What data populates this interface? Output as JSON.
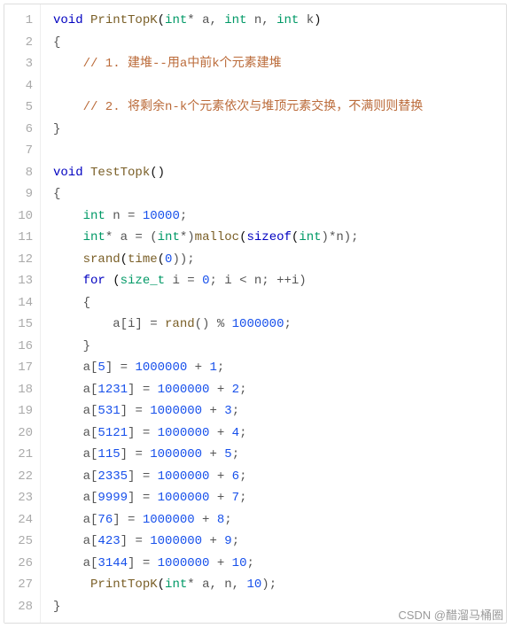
{
  "watermark": "CSDN @醋溜马桶圈",
  "lines": [
    {
      "n": "1",
      "tokens": [
        {
          "t": "void ",
          "c": "kw"
        },
        {
          "t": "PrintTopK",
          "c": "fn"
        },
        {
          "t": "(",
          "c": "paren"
        },
        {
          "t": "int",
          "c": "type"
        },
        {
          "t": "* a, ",
          "c": "punct"
        },
        {
          "t": "int",
          "c": "type"
        },
        {
          "t": " n, ",
          "c": "punct"
        },
        {
          "t": "int",
          "c": "type"
        },
        {
          "t": " k",
          "c": "punct"
        },
        {
          "t": ")",
          "c": "paren"
        }
      ]
    },
    {
      "n": "2",
      "tokens": [
        {
          "t": "{",
          "c": "punct"
        }
      ]
    },
    {
      "n": "3",
      "tokens": [
        {
          "t": "    // 1. 建堆--用a中前k个元素建堆",
          "c": "comment"
        }
      ]
    },
    {
      "n": "4",
      "tokens": [
        {
          "t": "",
          "c": ""
        }
      ]
    },
    {
      "n": "5",
      "tokens": [
        {
          "t": "    // 2. 将剩余n-k个元素依次与堆顶元素交换，不满则则替换",
          "c": "comment"
        }
      ]
    },
    {
      "n": "6",
      "tokens": [
        {
          "t": "}",
          "c": "punct"
        }
      ]
    },
    {
      "n": "7",
      "tokens": [
        {
          "t": "",
          "c": ""
        }
      ]
    },
    {
      "n": "8",
      "tokens": [
        {
          "t": "void ",
          "c": "kw"
        },
        {
          "t": "TestTopk",
          "c": "fn"
        },
        {
          "t": "()",
          "c": "paren"
        }
      ]
    },
    {
      "n": "9",
      "tokens": [
        {
          "t": "{",
          "c": "punct"
        }
      ]
    },
    {
      "n": "10",
      "tokens": [
        {
          "t": "    ",
          "c": ""
        },
        {
          "t": "int",
          "c": "type"
        },
        {
          "t": " n = ",
          "c": "punct"
        },
        {
          "t": "10000",
          "c": "num"
        },
        {
          "t": ";",
          "c": "punct"
        }
      ]
    },
    {
      "n": "11",
      "tokens": [
        {
          "t": "    ",
          "c": ""
        },
        {
          "t": "int",
          "c": "type"
        },
        {
          "t": "* a = (",
          "c": "punct"
        },
        {
          "t": "int",
          "c": "type"
        },
        {
          "t": "*)",
          "c": "punct"
        },
        {
          "t": "malloc",
          "c": "fn"
        },
        {
          "t": "(",
          "c": "paren"
        },
        {
          "t": "sizeof",
          "c": "kw"
        },
        {
          "t": "(",
          "c": "paren"
        },
        {
          "t": "int",
          "c": "type"
        },
        {
          "t": ")*n);",
          "c": "punct"
        }
      ]
    },
    {
      "n": "12",
      "tokens": [
        {
          "t": "    ",
          "c": ""
        },
        {
          "t": "srand",
          "c": "fn"
        },
        {
          "t": "(",
          "c": "paren"
        },
        {
          "t": "time",
          "c": "fn"
        },
        {
          "t": "(",
          "c": "paren"
        },
        {
          "t": "0",
          "c": "num"
        },
        {
          "t": "));",
          "c": "punct"
        }
      ]
    },
    {
      "n": "13",
      "tokens": [
        {
          "t": "    ",
          "c": ""
        },
        {
          "t": "for ",
          "c": "kw"
        },
        {
          "t": "(",
          "c": "paren"
        },
        {
          "t": "size_t",
          "c": "type"
        },
        {
          "t": " i = ",
          "c": "punct"
        },
        {
          "t": "0",
          "c": "num"
        },
        {
          "t": "; i < n; ++i)",
          "c": "punct"
        }
      ]
    },
    {
      "n": "14",
      "tokens": [
        {
          "t": "    {",
          "c": "punct"
        }
      ]
    },
    {
      "n": "15",
      "tokens": [
        {
          "t": "        a[i] = ",
          "c": "punct"
        },
        {
          "t": "rand",
          "c": "fn"
        },
        {
          "t": "() % ",
          "c": "punct"
        },
        {
          "t": "1000000",
          "c": "num"
        },
        {
          "t": ";",
          "c": "punct"
        }
      ]
    },
    {
      "n": "16",
      "tokens": [
        {
          "t": "    }",
          "c": "punct"
        }
      ]
    },
    {
      "n": "17",
      "tokens": [
        {
          "t": "    a[",
          "c": "punct"
        },
        {
          "t": "5",
          "c": "num"
        },
        {
          "t": "] = ",
          "c": "punct"
        },
        {
          "t": "1000000",
          "c": "num"
        },
        {
          "t": " + ",
          "c": "punct"
        },
        {
          "t": "1",
          "c": "num"
        },
        {
          "t": ";",
          "c": "punct"
        }
      ]
    },
    {
      "n": "18",
      "tokens": [
        {
          "t": "    a[",
          "c": "punct"
        },
        {
          "t": "1231",
          "c": "num"
        },
        {
          "t": "] = ",
          "c": "punct"
        },
        {
          "t": "1000000",
          "c": "num"
        },
        {
          "t": " + ",
          "c": "punct"
        },
        {
          "t": "2",
          "c": "num"
        },
        {
          "t": ";",
          "c": "punct"
        }
      ]
    },
    {
      "n": "19",
      "tokens": [
        {
          "t": "    a[",
          "c": "punct"
        },
        {
          "t": "531",
          "c": "num"
        },
        {
          "t": "] = ",
          "c": "punct"
        },
        {
          "t": "1000000",
          "c": "num"
        },
        {
          "t": " + ",
          "c": "punct"
        },
        {
          "t": "3",
          "c": "num"
        },
        {
          "t": ";",
          "c": "punct"
        }
      ]
    },
    {
      "n": "20",
      "tokens": [
        {
          "t": "    a[",
          "c": "punct"
        },
        {
          "t": "5121",
          "c": "num"
        },
        {
          "t": "] = ",
          "c": "punct"
        },
        {
          "t": "1000000",
          "c": "num"
        },
        {
          "t": " + ",
          "c": "punct"
        },
        {
          "t": "4",
          "c": "num"
        },
        {
          "t": ";",
          "c": "punct"
        }
      ]
    },
    {
      "n": "21",
      "tokens": [
        {
          "t": "    a[",
          "c": "punct"
        },
        {
          "t": "115",
          "c": "num"
        },
        {
          "t": "] = ",
          "c": "punct"
        },
        {
          "t": "1000000",
          "c": "num"
        },
        {
          "t": " + ",
          "c": "punct"
        },
        {
          "t": "5",
          "c": "num"
        },
        {
          "t": ";",
          "c": "punct"
        }
      ]
    },
    {
      "n": "22",
      "tokens": [
        {
          "t": "    a[",
          "c": "punct"
        },
        {
          "t": "2335",
          "c": "num"
        },
        {
          "t": "] = ",
          "c": "punct"
        },
        {
          "t": "1000000",
          "c": "num"
        },
        {
          "t": " + ",
          "c": "punct"
        },
        {
          "t": "6",
          "c": "num"
        },
        {
          "t": ";",
          "c": "punct"
        }
      ]
    },
    {
      "n": "23",
      "tokens": [
        {
          "t": "    a[",
          "c": "punct"
        },
        {
          "t": "9999",
          "c": "num"
        },
        {
          "t": "] = ",
          "c": "punct"
        },
        {
          "t": "1000000",
          "c": "num"
        },
        {
          "t": " + ",
          "c": "punct"
        },
        {
          "t": "7",
          "c": "num"
        },
        {
          "t": ";",
          "c": "punct"
        }
      ]
    },
    {
      "n": "24",
      "tokens": [
        {
          "t": "    a[",
          "c": "punct"
        },
        {
          "t": "76",
          "c": "num"
        },
        {
          "t": "] = ",
          "c": "punct"
        },
        {
          "t": "1000000",
          "c": "num"
        },
        {
          "t": " + ",
          "c": "punct"
        },
        {
          "t": "8",
          "c": "num"
        },
        {
          "t": ";",
          "c": "punct"
        }
      ]
    },
    {
      "n": "25",
      "tokens": [
        {
          "t": "    a[",
          "c": "punct"
        },
        {
          "t": "423",
          "c": "num"
        },
        {
          "t": "] = ",
          "c": "punct"
        },
        {
          "t": "1000000",
          "c": "num"
        },
        {
          "t": " + ",
          "c": "punct"
        },
        {
          "t": "9",
          "c": "num"
        },
        {
          "t": ";",
          "c": "punct"
        }
      ]
    },
    {
      "n": "26",
      "tokens": [
        {
          "t": "    a[",
          "c": "punct"
        },
        {
          "t": "3144",
          "c": "num"
        },
        {
          "t": "] = ",
          "c": "punct"
        },
        {
          "t": "1000000",
          "c": "num"
        },
        {
          "t": " + ",
          "c": "punct"
        },
        {
          "t": "10",
          "c": "num"
        },
        {
          "t": ";",
          "c": "punct"
        }
      ]
    },
    {
      "n": "27",
      "tokens": [
        {
          "t": "     ",
          "c": ""
        },
        {
          "t": "PrintTopK",
          "c": "fn"
        },
        {
          "t": "(",
          "c": "paren"
        },
        {
          "t": "int",
          "c": "type"
        },
        {
          "t": "* a, n, ",
          "c": "punct"
        },
        {
          "t": "10",
          "c": "num"
        },
        {
          "t": ");",
          "c": "punct"
        }
      ]
    },
    {
      "n": "28",
      "tokens": [
        {
          "t": "}",
          "c": "punct"
        }
      ]
    }
  ]
}
